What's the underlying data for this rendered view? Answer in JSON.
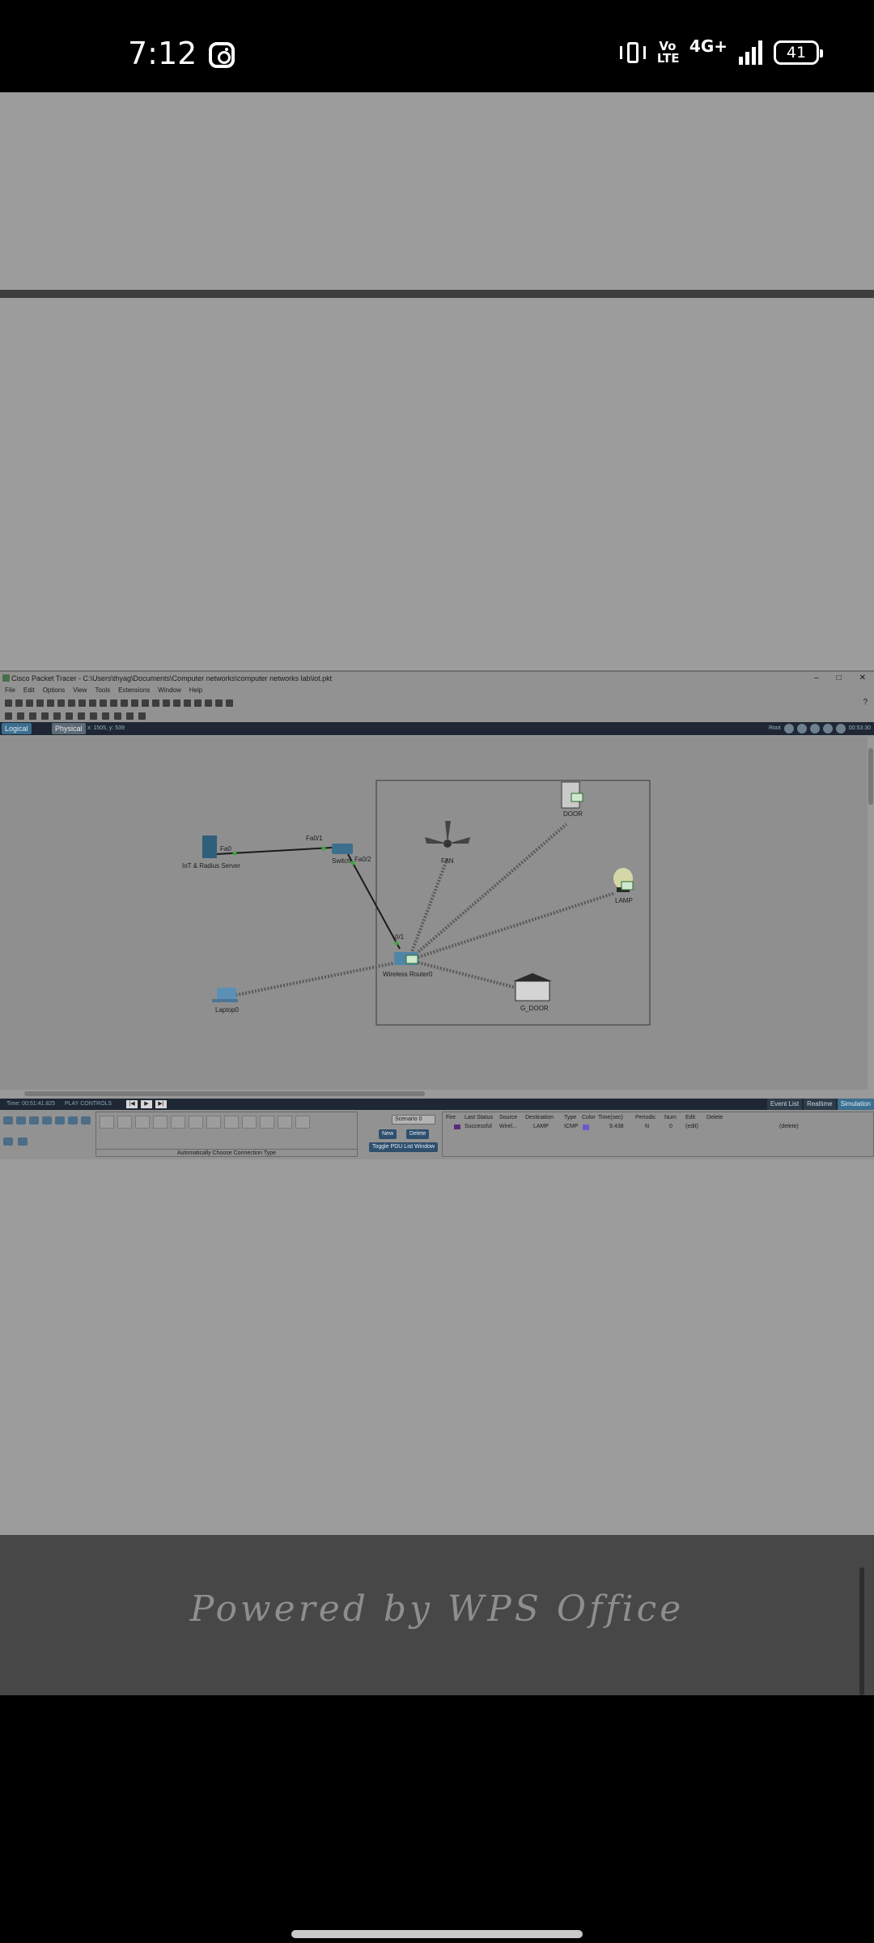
{
  "status_bar": {
    "time": "7:12",
    "volte": "Vo LTE",
    "network": "4G+",
    "battery": "41",
    "icons": [
      "instagram-icon",
      "vibrate-icon",
      "signal-icon",
      "battery-icon"
    ]
  },
  "packet_tracer": {
    "title": "Cisco Packet Tracer - C:\\Users\\thyag\\Documents\\Computer networks\\computer networks lab\\iot.pkt",
    "menu": [
      "File",
      "Edit",
      "Options",
      "View",
      "Tools",
      "Extensions",
      "Window",
      "Help"
    ],
    "tabs": {
      "logical": "Logical",
      "physical": "Physical"
    },
    "coords": "x: 1505, y: 539",
    "root": "Root",
    "clock": "00:53:30",
    "devices": {
      "server": "IoT & Radius Server",
      "switch": "Switch",
      "router": "Wireless Router0",
      "fan": "FAN",
      "door": "DOOR",
      "lamp": "LAMP",
      "garage": "G_DOOR",
      "laptop": "Laptop0"
    },
    "ports": {
      "fa0": "Fa0",
      "fa01": "Fa0/1",
      "fa02": "Fa0/2",
      "p1": "0/1"
    },
    "simbar": {
      "time": "Time: 00:51:41.825",
      "play_controls": "PLAY CONTROLS",
      "event_list": "Event List",
      "realtime": "Realtime",
      "simulation": "Simulation"
    },
    "connection_caption": "Automatically Choose Connection Type",
    "scenario": {
      "select": "Scenario 0",
      "new": "New",
      "delete": "Delete",
      "toggle": "Toggle PDU List Window"
    },
    "pdu_table": {
      "headers": [
        "Fire",
        "Last Status",
        "Source",
        "Destination",
        "Type",
        "Color",
        "Time(sec)",
        "Periodic",
        "Num",
        "Edit",
        "Delete"
      ],
      "row": [
        "Successful",
        "Wirel...",
        "LAMP",
        "ICMP",
        "",
        "9.438",
        "N",
        "0",
        "(edit)",
        "(delete)"
      ]
    }
  },
  "footer": {
    "text": "Powered by WPS Office"
  }
}
